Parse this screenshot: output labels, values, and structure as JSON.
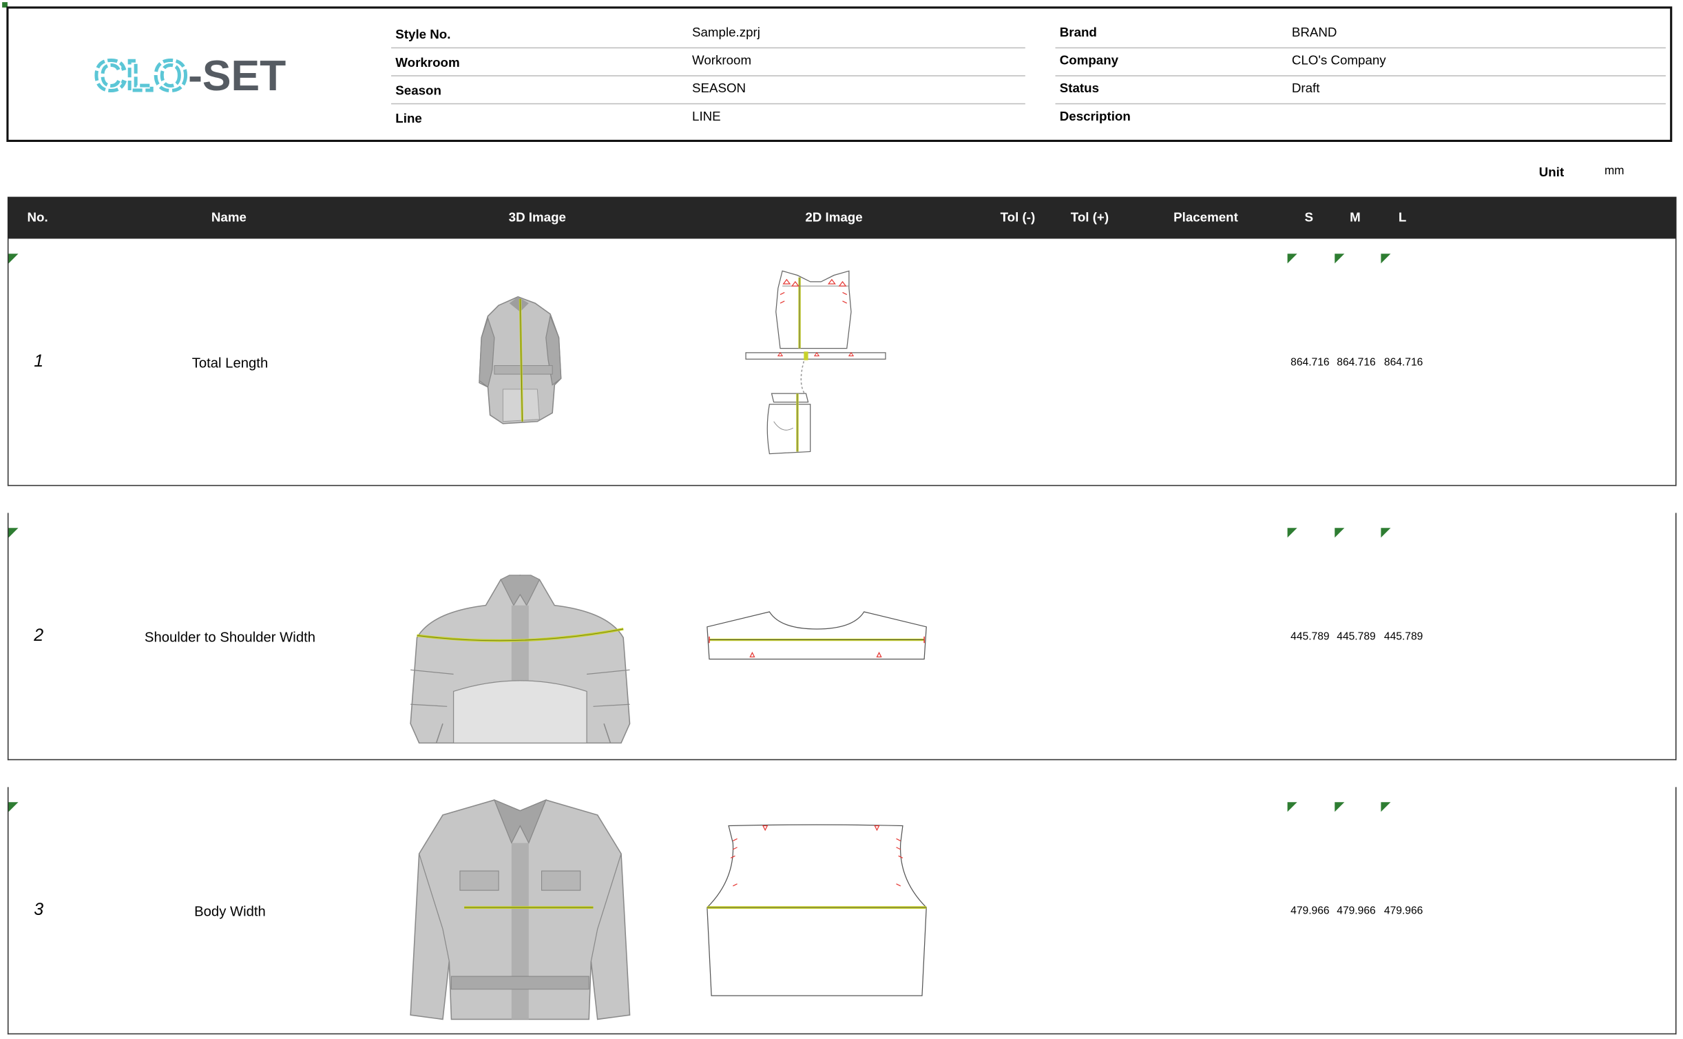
{
  "header": {
    "logo_text": "CLO-SET",
    "fields": [
      {
        "label": "Style No.",
        "value": "Sample.zprj"
      },
      {
        "label": "Workroom",
        "value": "Workroom"
      },
      {
        "label": "Season",
        "value": "SEASON"
      },
      {
        "label": "Line",
        "value": "LINE"
      },
      {
        "label": "Brand",
        "value": "BRAND"
      },
      {
        "label": "Company",
        "value": "CLO's Company"
      },
      {
        "label": "Status",
        "value": "Draft"
      },
      {
        "label": "Description",
        "value": ""
      }
    ]
  },
  "unit": {
    "label": "Unit",
    "value": "mm"
  },
  "table": {
    "columns": [
      "No.",
      "Name",
      "3D Image",
      "2D Image",
      "Tol (-)",
      "Tol (+)",
      "Placement",
      "S",
      "M",
      "L"
    ],
    "rows": [
      {
        "no": "1",
        "name": "Total Length",
        "S": "864.716",
        "M": "864.716",
        "L": "864.716"
      },
      {
        "no": "2",
        "name": "Shoulder to Shoulder Width",
        "S": "445.789",
        "M": "445.789",
        "L": "445.789"
      },
      {
        "no": "3",
        "name": "Body Width",
        "S": "479.966",
        "M": "479.966",
        "L": "479.966"
      }
    ]
  },
  "colors": {
    "header_bar": "#262626",
    "flag": "#2e7d32",
    "logo_cyan": "#5bc6d6",
    "logo_gray": "#555b62",
    "measure_line": "#c8d22b",
    "notch": "#e53935"
  },
  "icons": {
    "row_marker": "green-triangle-flag"
  }
}
